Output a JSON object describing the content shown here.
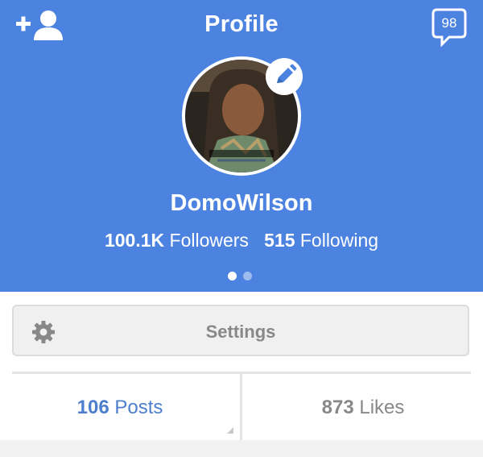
{
  "header": {
    "title": "Profile",
    "message_count": "98",
    "icons": [
      "add-user-icon",
      "message-icon",
      "edit-pencil-icon"
    ],
    "background_color": "#4d83e0"
  },
  "profile": {
    "username": "DomoWilson",
    "followers_count": "100.1K",
    "followers_label": "Followers",
    "following_count": "515",
    "following_label": "Following",
    "page_dots": {
      "total": 2,
      "active_index": 0
    }
  },
  "settings": {
    "label": "Settings",
    "icon": "gear-icon"
  },
  "tabs": [
    {
      "count": "106",
      "label": "Posts",
      "active": true
    },
    {
      "count": "873",
      "label": "Likes",
      "active": false
    }
  ]
}
